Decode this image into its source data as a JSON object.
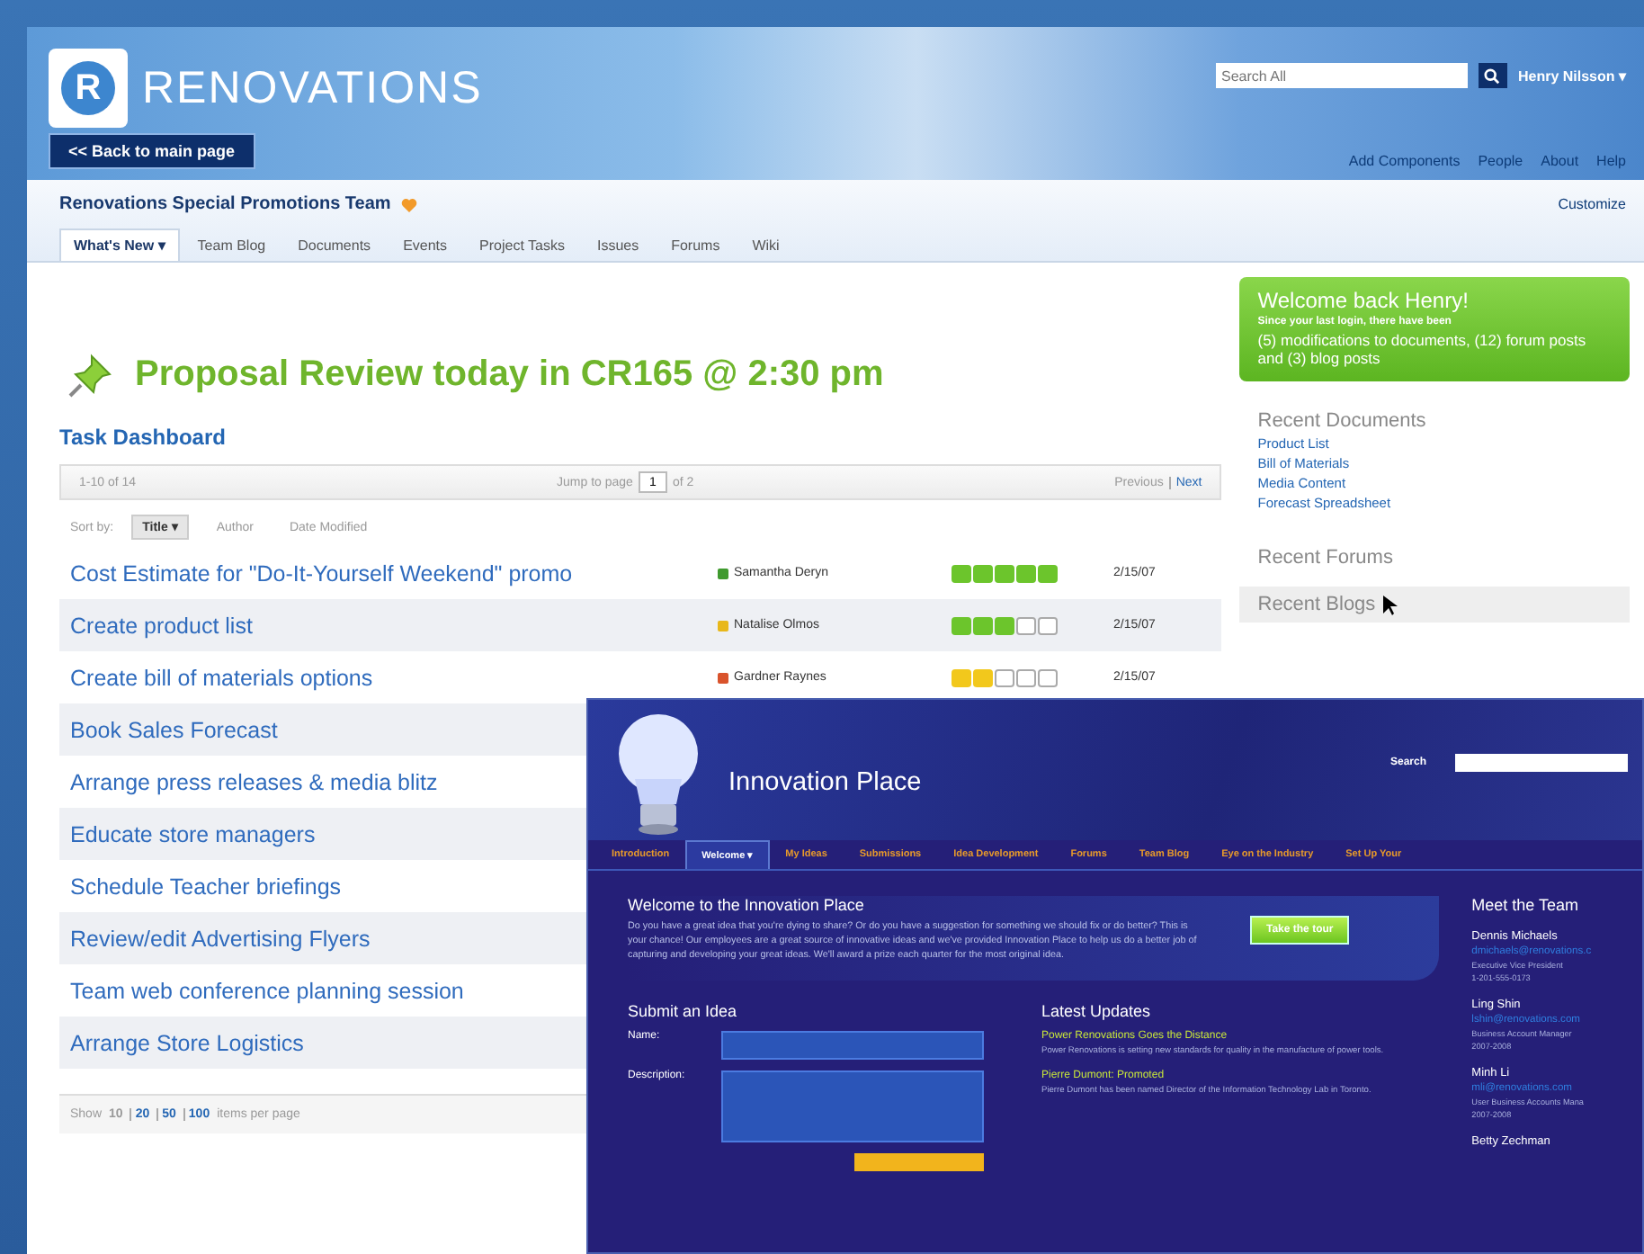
{
  "portal": {
    "logo": {
      "mark": "R",
      "text": "RENOVATIONS"
    },
    "back_button": "<< Back to main page",
    "search": {
      "placeholder": "Search All"
    },
    "user_menu": "Henry Nilsson ▾",
    "top_links": [
      "Add Components",
      "People",
      "About",
      "Help"
    ],
    "team": {
      "title": "Renovations Special Promotions Team",
      "action": "Customize"
    },
    "tabs": [
      {
        "label": "What's New ▾",
        "selected": true
      },
      {
        "label": "Team Blog",
        "selected": false
      },
      {
        "label": "Documents",
        "selected": false
      },
      {
        "label": "Events",
        "selected": false
      },
      {
        "label": "Project Tasks",
        "selected": false
      },
      {
        "label": "Issues",
        "selected": false
      },
      {
        "label": "Forums",
        "selected": false
      },
      {
        "label": "Wiki",
        "selected": false
      }
    ],
    "headline": "Proposal Review today in CR165 @ 2:30 pm",
    "dashboard": {
      "title": "Task Dashboard",
      "range": "1-10 of 14",
      "jump_label": "Jump to page",
      "page": "1",
      "page_total": "of 2",
      "previous": {
        "label": "Previous",
        "disabled": true
      },
      "next": {
        "label": "Next",
        "disabled": false
      },
      "sort_label": "Sort by:",
      "sort_options": [
        {
          "label": "Title ▾",
          "selected": true
        },
        {
          "label": "Author",
          "selected": false
        },
        {
          "label": "Date Modified",
          "selected": false
        }
      ],
      "tasks": [
        {
          "title": "Cost Estimate for \"Do-It-Yourself Weekend\" promo",
          "assignee": {
            "name": "Samantha Deryn",
            "color": "#3f9a2e"
          },
          "progress": {
            "stars": 5,
            "color": "#6cc52c"
          },
          "date": "2/15/07"
        },
        {
          "title": "Create product list",
          "assignee": {
            "name": "Natalise Olmos",
            "color": "#e8b81a"
          },
          "progress": {
            "stars": 3,
            "color": "#6cc52c"
          },
          "date": "2/15/07"
        },
        {
          "title": "Create bill of materials options",
          "assignee": {
            "name": "Gardner Raynes",
            "color": "#d9532c"
          },
          "progress": {
            "stars": 2,
            "color": "#f2c81c"
          },
          "date": "2/15/07"
        },
        {
          "title": "Book Sales Forecast"
        },
        {
          "title": "Arrange press releases & media blitz"
        },
        {
          "title": "Educate store managers"
        },
        {
          "title": "Schedule Teacher briefings"
        },
        {
          "title": "Review/edit Advertising Flyers"
        },
        {
          "title": "Team web conference planning session"
        },
        {
          "title": "Arrange Store Logistics"
        }
      ],
      "per_page": {
        "before": "Show",
        "options": [
          {
            "label": "10",
            "selected": true
          },
          {
            "label": "20",
            "selected": false
          },
          {
            "label": "50",
            "selected": false
          },
          {
            "label": "100",
            "selected": false
          }
        ],
        "after": "items per page"
      }
    },
    "welcome": {
      "title": "Welcome back Henry!",
      "intro": "Since your last login, there have been",
      "summary": "(5) modifications to documents, (12) forum posts and (3) blog posts"
    },
    "recent_documents": {
      "title": "Recent Documents",
      "items": [
        "Product List",
        "Bill of Materials",
        "Media Content",
        "Forecast Spreadsheet"
      ]
    },
    "recent_forums": {
      "title": "Recent Forums"
    },
    "recent_blogs": {
      "title": "Recent Blogs"
    }
  },
  "innovation": {
    "title": "Innovation Place",
    "search_label": "Search",
    "nav": [
      {
        "label": "Introduction",
        "selected": false
      },
      {
        "label": "Welcome ▾",
        "selected": true
      },
      {
        "label": "My Ideas",
        "selected": false
      },
      {
        "label": "Submissions",
        "selected": false
      },
      {
        "label": "Idea Development",
        "selected": false
      },
      {
        "label": "Forums",
        "selected": false
      },
      {
        "label": "Team Blog",
        "selected": false
      },
      {
        "label": "Eye on the Industry",
        "selected": false
      },
      {
        "label": "Set Up Your",
        "selected": false
      }
    ],
    "intro": {
      "title": "Welcome to the Innovation Place",
      "text": "Do you have a great idea that you're dying to share? Or do you have a suggestion for something we should fix or do better? This is your chance! Our employees are a great source of innovative ideas and we've provided Innovation Place to help us do a better job of capturing and developing your great ideas. We'll award a prize each quarter for the most original idea.",
      "button": "Take the tour"
    },
    "submit": {
      "title": "Submit an Idea",
      "fields": [
        {
          "label": "Name:",
          "kind": "line"
        },
        {
          "label": "Description:",
          "kind": "area"
        }
      ]
    },
    "updates": {
      "title": "Latest Updates",
      "items": [
        {
          "headline": "Power Renovations Goes the Distance",
          "text": "Power Renovations is setting new standards for quality in the manufacture of power tools."
        },
        {
          "headline": "Pierre Dumont: Promoted",
          "text": "Pierre Dumont has been named Director of the Information Technology Lab in Toronto."
        }
      ]
    },
    "team": {
      "title": "Meet the Team",
      "members": [
        {
          "name": "Dennis Michaels",
          "email": "dmichaels@renovations.c",
          "role": "Executive Vice President",
          "phone": "1-201-555-0173"
        },
        {
          "name": "Ling Shin",
          "email": "lshin@renovations.com",
          "role": "Business Account Manager",
          "phone": "2007-2008"
        },
        {
          "name": "Minh Li",
          "email": "mli@renovations.com",
          "role": "User Business Accounts Mana",
          "phone": "2007-2008"
        },
        {
          "name": "Betty Zechman"
        }
      ]
    }
  }
}
